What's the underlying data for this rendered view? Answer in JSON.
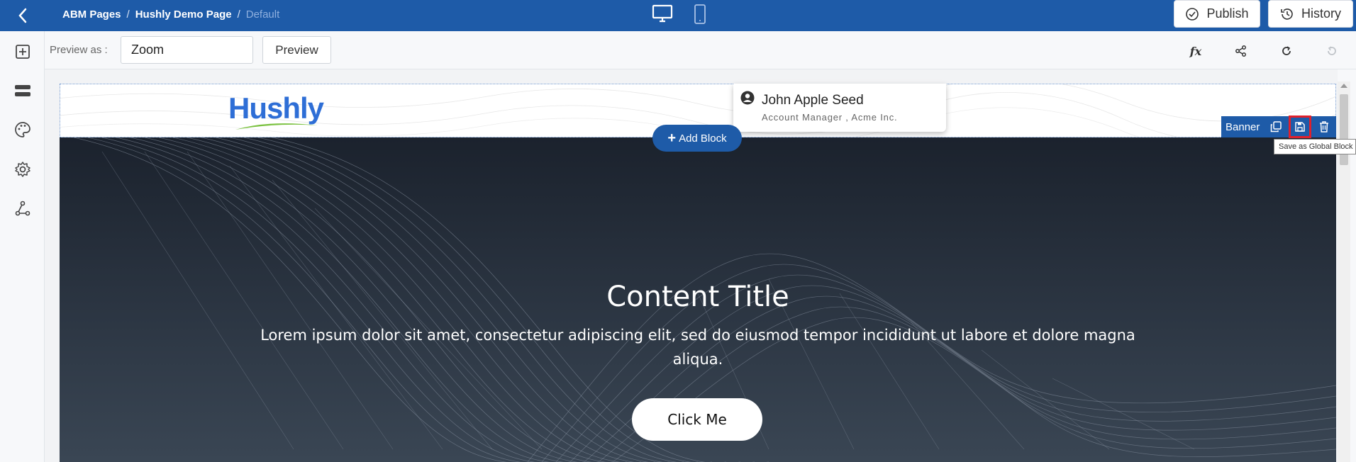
{
  "topbar": {
    "breadcrumb": [
      "ABM Pages",
      "Hushly Demo Page",
      "Default"
    ],
    "separator": "/",
    "publish_label": "Publish",
    "history_label": "History"
  },
  "toolbar": {
    "preview_label": "Preview as :",
    "preview_value": "Zoom",
    "preview_button": "Preview",
    "fx_label": "fx"
  },
  "header_block": {
    "logo_text": "Hushly",
    "contact_name": "John Apple Seed",
    "contact_title": "Account Manager , Acme Inc."
  },
  "block_controls": {
    "add_block_label": "Add Block",
    "block_type": "Banner",
    "tooltip": "Save as Global Block"
  },
  "banner": {
    "title": "Content Title",
    "body": "Lorem ipsum dolor sit amet, consectetur adipiscing elit, sed do eiusmod tempor incididunt ut labore et dolore magna aliqua.",
    "cta": "Click Me"
  },
  "colors": {
    "primary": "#1e5ba8",
    "highlight": "#e0202c",
    "logo": "#2e6ed6"
  },
  "icons": {
    "sidebar": [
      "add-block-icon",
      "layers-icon",
      "palette-icon",
      "settings-icon",
      "workflow-icon"
    ],
    "toolbar": [
      "fx-icon",
      "share-icon",
      "refresh-icon",
      "redo-icon"
    ],
    "block": [
      "duplicate-icon",
      "save-global-icon",
      "delete-icon"
    ]
  }
}
